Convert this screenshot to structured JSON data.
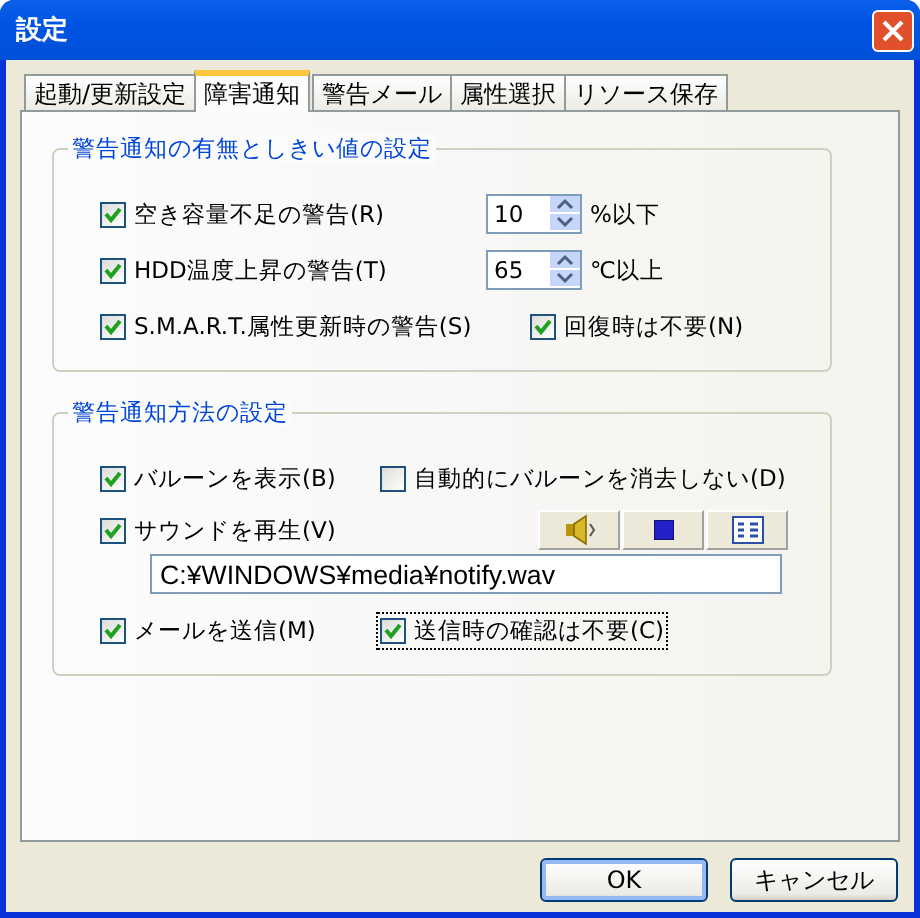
{
  "window": {
    "title": "設定"
  },
  "tabs": [
    {
      "label": "起動/更新設定",
      "selected": false
    },
    {
      "label": "障害通知",
      "selected": true
    },
    {
      "label": "警告メール",
      "selected": false
    },
    {
      "label": "属性選択",
      "selected": false
    },
    {
      "label": "リソース保存",
      "selected": false
    }
  ],
  "threshold_group": {
    "title": "警告通知の有無としきい値の設定",
    "items": [
      {
        "kind": "spin",
        "label": "空き容量不足の警告(R)",
        "checked": true,
        "value": "10",
        "unit": "%以下"
      },
      {
        "kind": "spin",
        "label": "HDD温度上昇の警告(T)",
        "checked": true,
        "value": "65",
        "unit": "℃以上"
      },
      {
        "kind": "pair",
        "label": "S.M.A.R.T.属性更新時の警告(S)",
        "checked": true,
        "second": {
          "label": "回復時は不要(N)",
          "checked": true,
          "focused": false
        }
      }
    ]
  },
  "method_group": {
    "title": "警告通知方法の設定",
    "items": [
      {
        "kind": "pair",
        "label": "バルーンを表示(B)",
        "checked": true,
        "second": {
          "label": "自動的にバルーンを消去しない(D)",
          "checked": false,
          "focused": false
        }
      },
      {
        "kind": "sound",
        "label": "サウンドを再生(V)",
        "checked": true,
        "path": "C:¥WINDOWS¥media¥notify.wav"
      },
      {
        "kind": "pair",
        "label": "メールを送信(M)",
        "checked": true,
        "second": {
          "label": "送信時の確認は不要(C)",
          "checked": true,
          "focused": true
        }
      }
    ]
  },
  "buttons": [
    {
      "label": "OK",
      "default": true
    },
    {
      "label": "キャンセル",
      "default": false
    }
  ]
}
